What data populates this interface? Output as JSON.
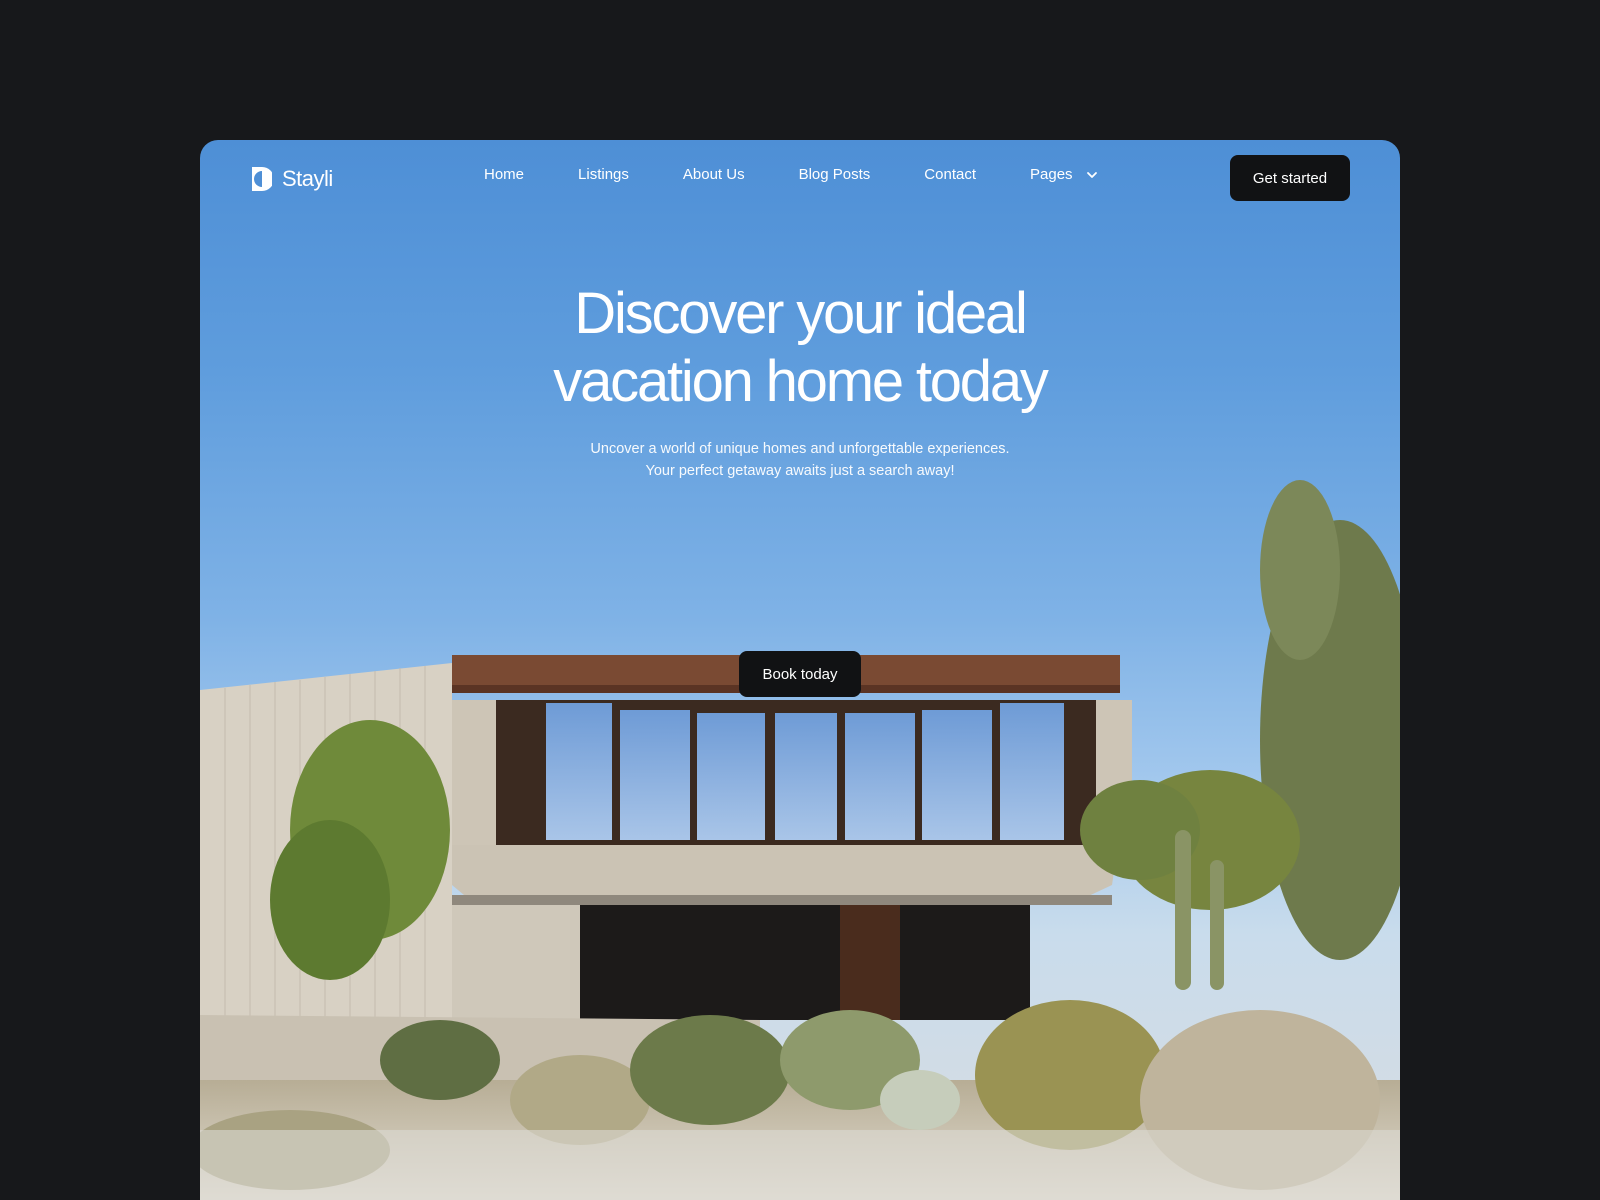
{
  "brand": {
    "name": "Stayli",
    "logo_icon": "half-circle-logo-icon"
  },
  "nav": {
    "items": [
      {
        "label": "Home"
      },
      {
        "label": "Listings"
      },
      {
        "label": "About Us"
      },
      {
        "label": "Blog Posts"
      },
      {
        "label": "Contact"
      },
      {
        "label": "Pages",
        "icon": "chevron-down-icon"
      }
    ],
    "cta_label": "Get started"
  },
  "hero": {
    "title_line1": "Discover your ideal",
    "title_line2": "vacation home today",
    "subtitle_line1": "Uncover a world of unique homes and unforgettable experiences.",
    "subtitle_line2": "Your perfect getaway awaits just a search away!",
    "cta_label": "Book today"
  },
  "colors": {
    "page_background": "#17181b",
    "sky_top": "#4e8fd6",
    "button_background": "#111214",
    "text_light": "#ffffff"
  }
}
